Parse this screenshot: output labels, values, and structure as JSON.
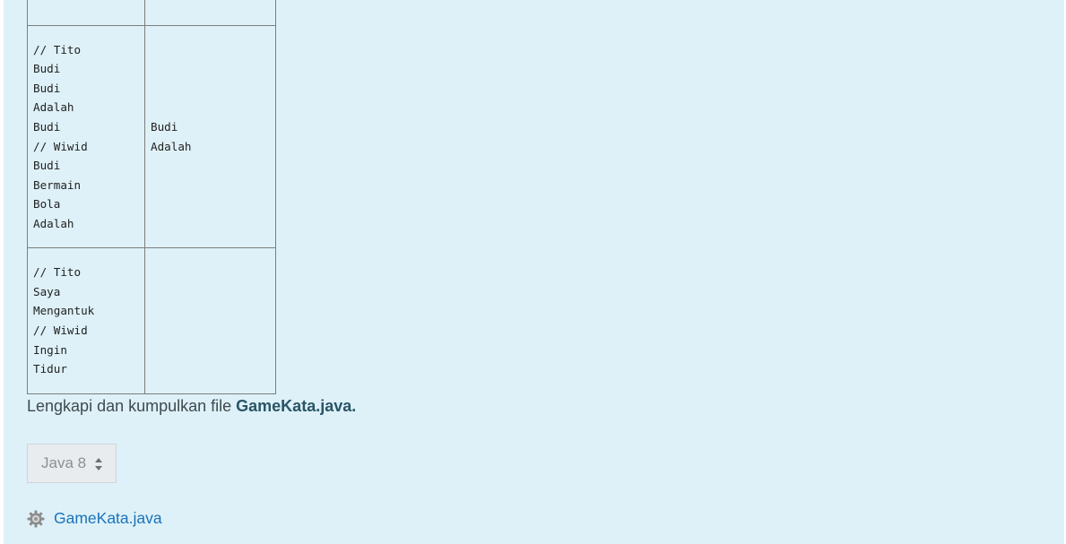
{
  "io_table": {
    "rows": [
      {
        "input": "",
        "output": ""
      },
      {
        "input": "// Tito\nBudi\nBudi\nAdalah\nBudi\n// Wiwid\nBudi\nBermain\nBola\nAdalah",
        "output": "Budi\nAdalah"
      },
      {
        "input": "// Tito\nSaya\nMengantuk\n// Wiwid\nIngin\nTidur",
        "output": ""
      }
    ]
  },
  "instruction": {
    "text": "Lengkapi dan kumpulkan file ",
    "filename": "GameKata.java."
  },
  "language_select": {
    "selected": "Java 8"
  },
  "submission_file": {
    "icon": "gear-icon",
    "name": "GameKata.java"
  },
  "colors": {
    "panel_bg": "#def1f8",
    "link": "#1a73ba"
  }
}
